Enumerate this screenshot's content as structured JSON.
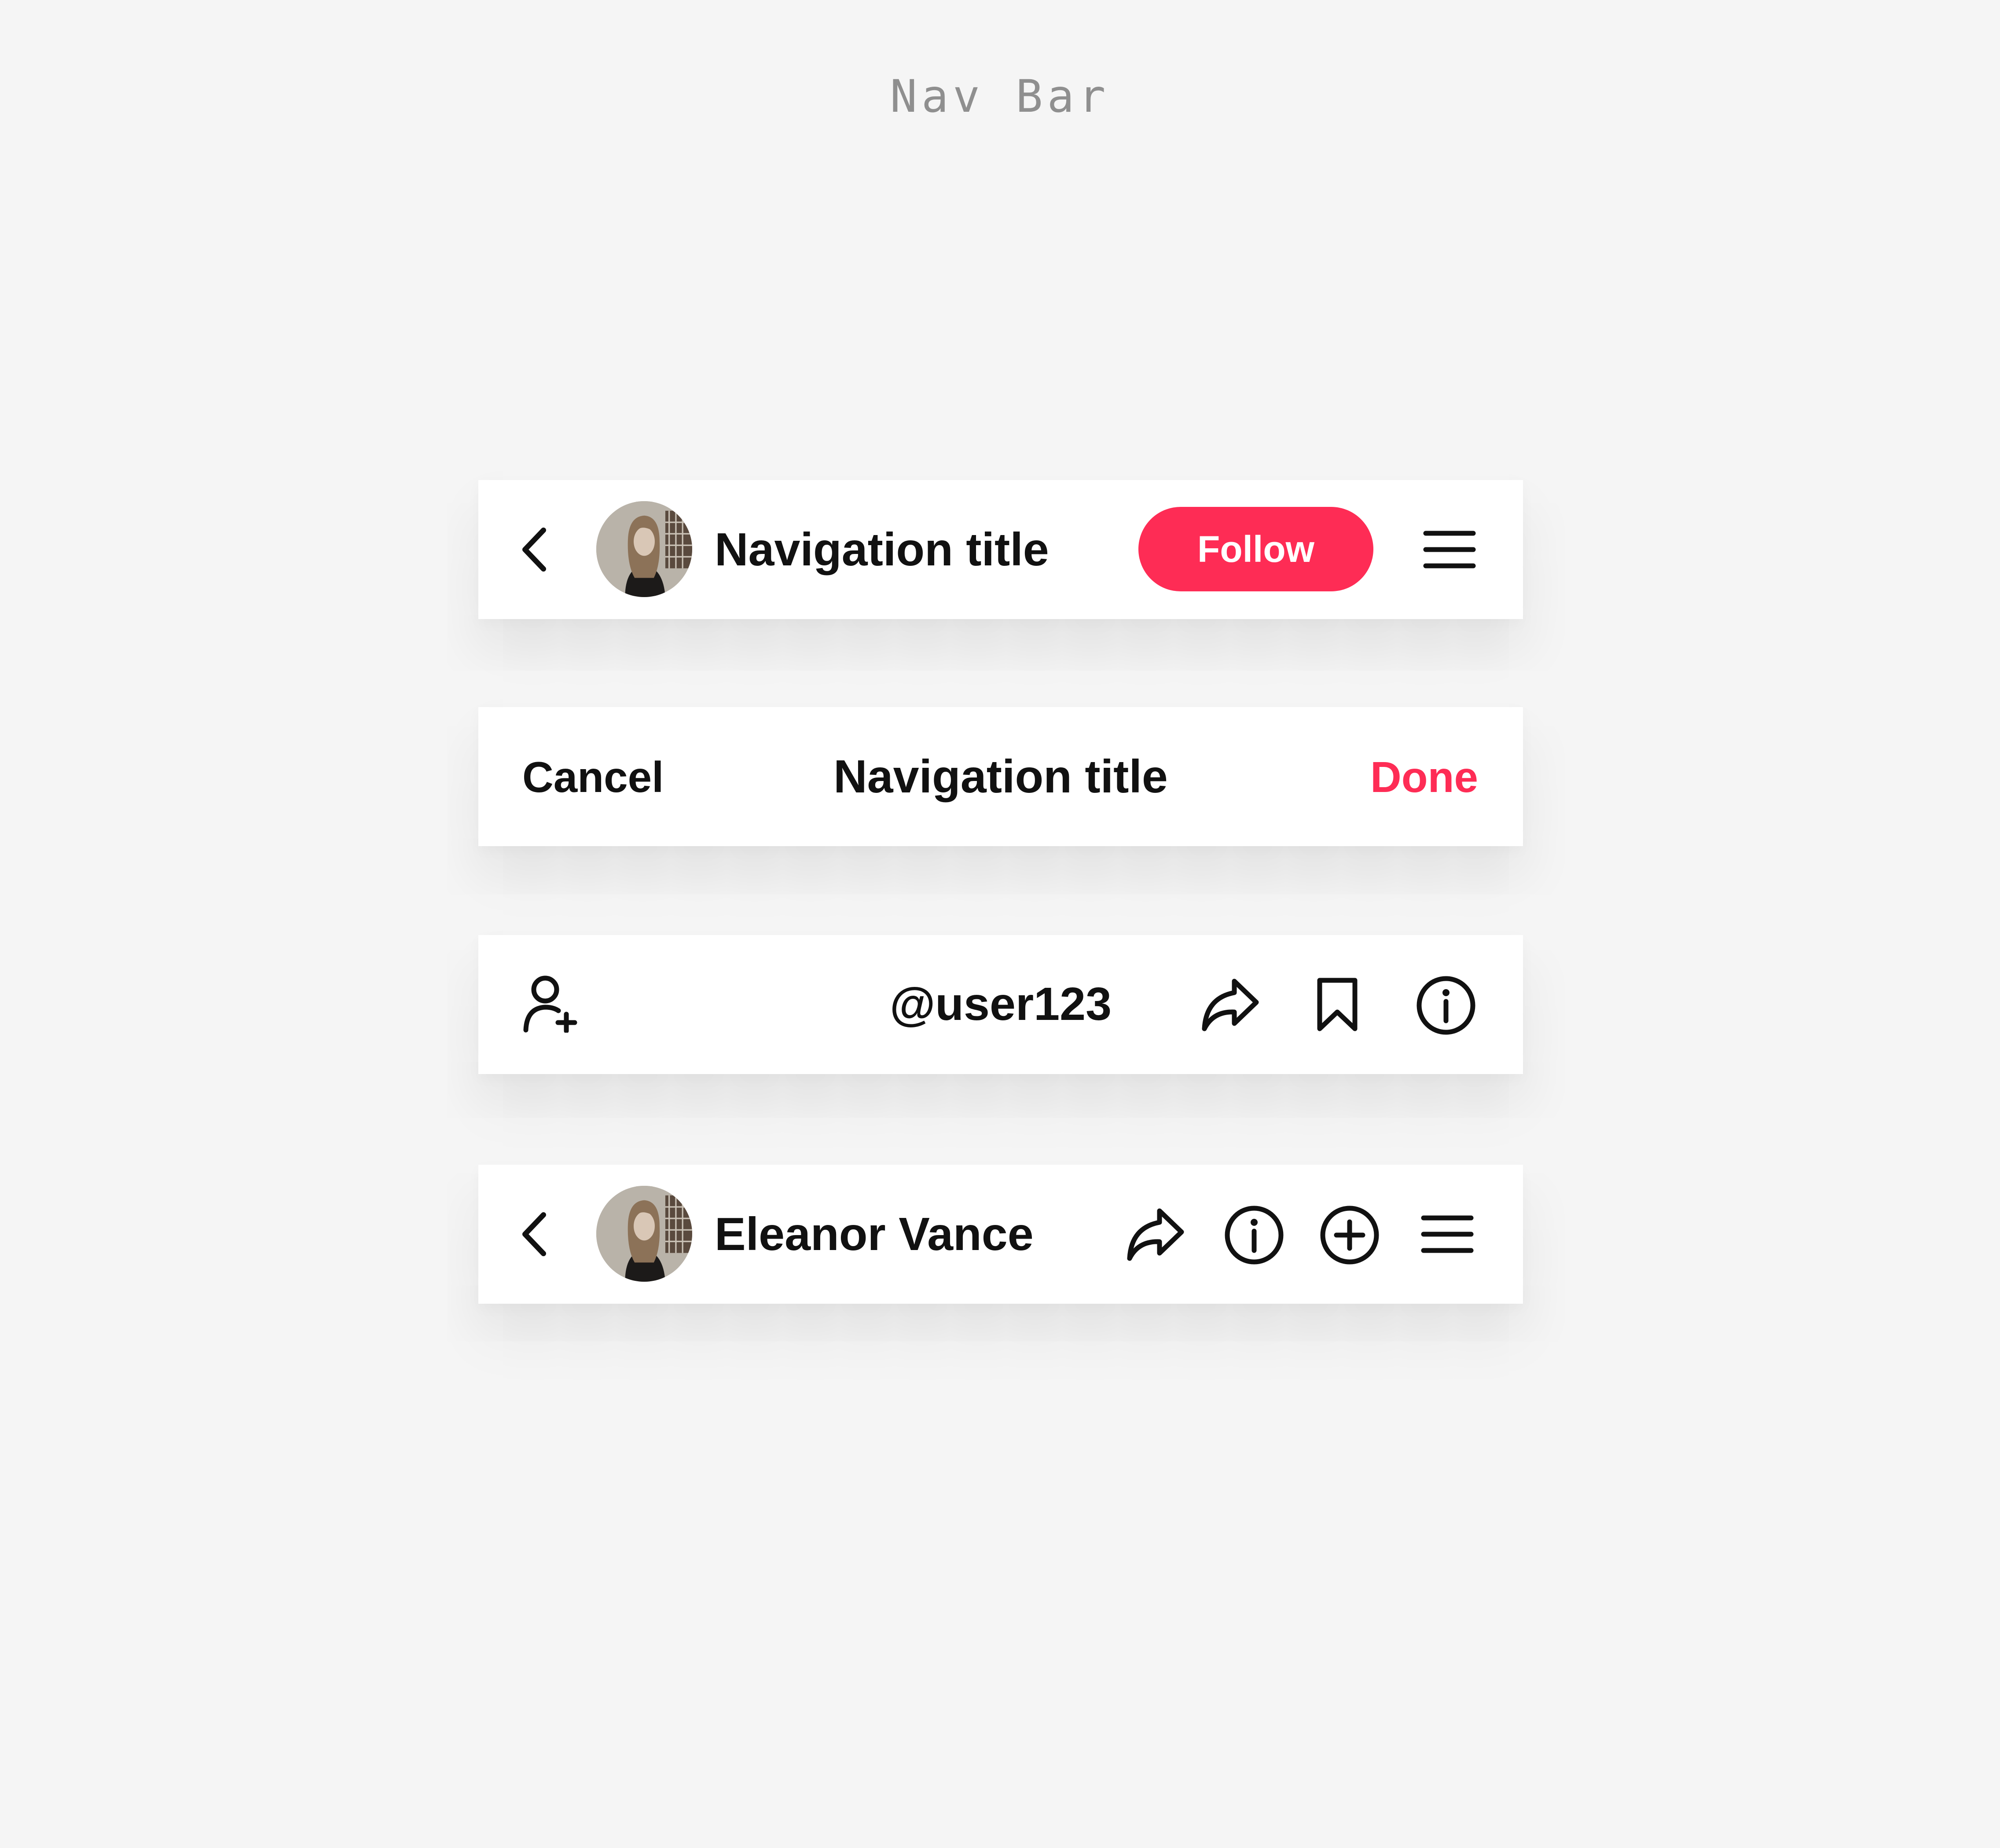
{
  "page": {
    "section_title": "Nav Bar"
  },
  "bar1": {
    "back_icon": "chevron-left-icon",
    "title": "Navigation title",
    "follow_label": "Follow",
    "menu_icon": "hamburger-menu-icon"
  },
  "bar2": {
    "cancel_label": "Cancel",
    "title": "Navigation title",
    "done_label": "Done"
  },
  "bar3": {
    "add_user_icon": "person-add-icon",
    "title": "@user123",
    "share_icon": "share-arrow-icon",
    "bookmark_icon": "bookmark-icon",
    "info_icon": "info-circle-icon"
  },
  "bar4": {
    "back_icon": "chevron-left-icon",
    "title": "Eleanor Vance",
    "share_icon": "share-arrow-icon",
    "info_icon": "info-circle-icon",
    "add_icon": "plus-circle-icon",
    "menu_icon": "hamburger-menu-icon"
  },
  "colors": {
    "accent": "#fe2c55",
    "text": "#111111",
    "background": "#f5f5f5",
    "bar_background": "#ffffff",
    "section_title": "#8f8f8f"
  }
}
